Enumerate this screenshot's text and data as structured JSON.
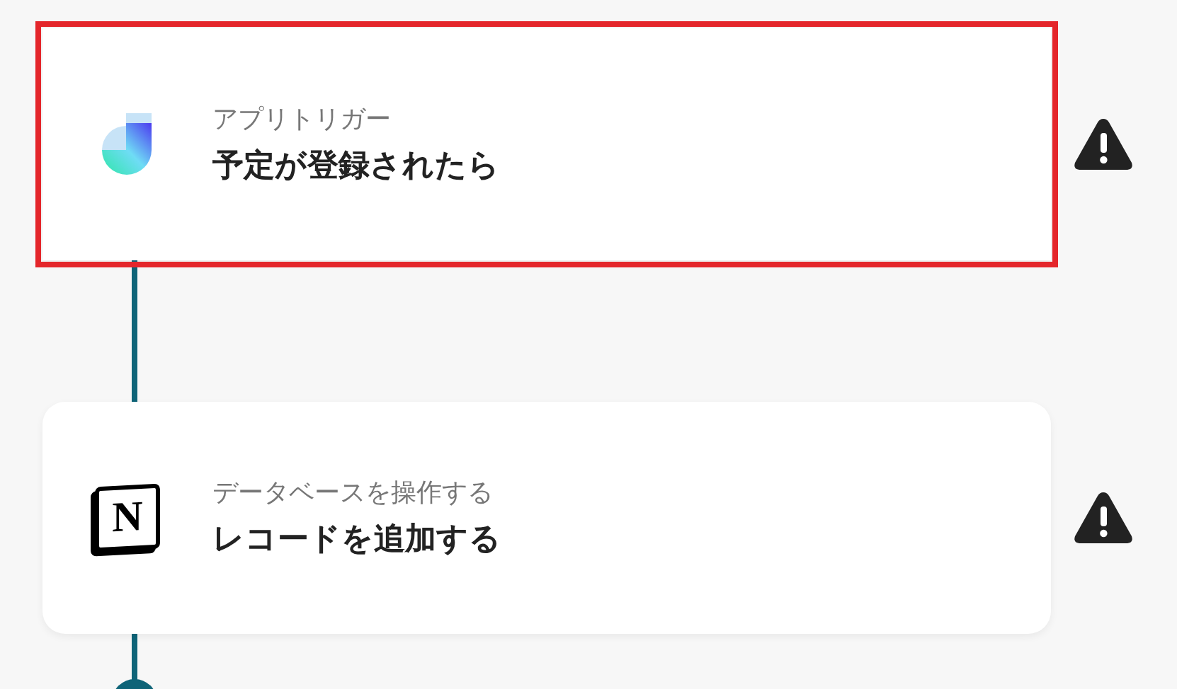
{
  "steps": [
    {
      "kind": "trigger",
      "selected": true,
      "subtitle": "アプリトリガー",
      "title": "予定が登録されたら",
      "warning": true
    },
    {
      "kind": "notion",
      "selected": false,
      "subtitle": "データベースを操作する",
      "title": "レコードを追加する",
      "warning": true,
      "logo_text": "N"
    }
  ]
}
